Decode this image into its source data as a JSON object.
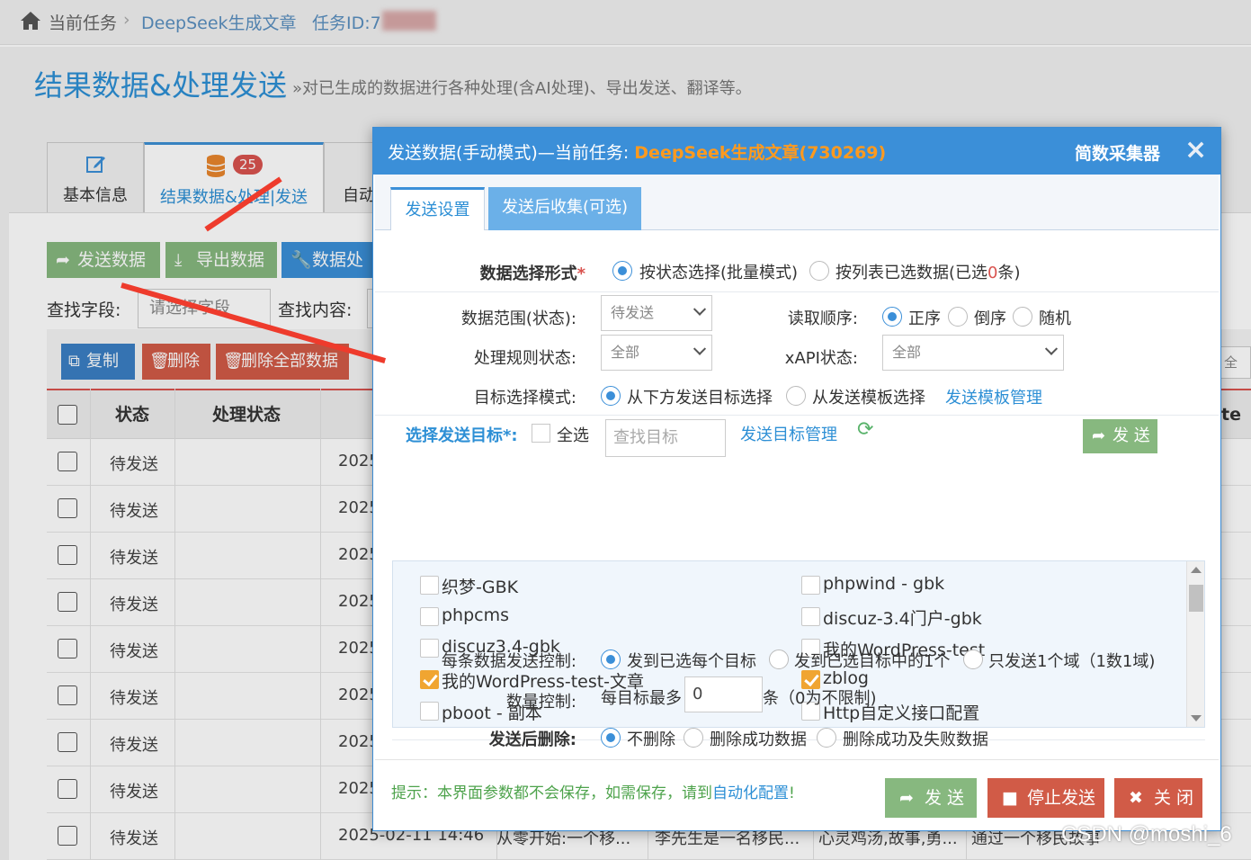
{
  "breadcrumb": {
    "current_task": "当前任务",
    "task_name": "DeepSeek生成文章",
    "task_id": "任务ID:7"
  },
  "page": {
    "title": "结果数据&处理发送",
    "subtitle": "»对已生成的数据进行各种处理(含AI处理)、导出发送、翻译等。"
  },
  "tabs": [
    {
      "label": "基本信息"
    },
    {
      "label": "结果数据&处理|发送",
      "badge": "25"
    },
    {
      "label": "自动"
    }
  ],
  "toolbar": {
    "send": "发送数据",
    "export": "导出数据",
    "process": "数据处"
  },
  "search": {
    "field_label": "查找字段:",
    "field_placeholder": "请选择字段",
    "content_label": "查找内容:"
  },
  "actions": {
    "copy": "复制",
    "delete": "删除",
    "delete_all": "删除全部数据",
    "right_hint": "全部"
  },
  "table": {
    "headers": [
      "状态",
      "处理状态",
      "",
      "te"
    ],
    "rows": [
      {
        "status": "待发送",
        "date": "2025"
      },
      {
        "status": "待发送",
        "date": "2025"
      },
      {
        "status": "待发送",
        "date": "2025"
      },
      {
        "status": "待发送",
        "date": "2025"
      },
      {
        "status": "待发送",
        "date": "2025"
      },
      {
        "status": "待发送",
        "date": "2025"
      },
      {
        "status": "待发送",
        "date": "2025"
      },
      {
        "status": "待发送",
        "date": "2025"
      },
      {
        "status": "待发送",
        "date": "2025-02-11 14:46",
        "c1": "从零开始:一个移...",
        "c2": "李先生是一名移民...",
        "c3": "心灵鸡汤,故事,勇...",
        "c4": "通过一个移民故事"
      }
    ]
  },
  "modal": {
    "title_prefix": "发送数据(手动模式)—当前任务: ",
    "task": "DeepSeek生成文章(730269)",
    "brand": "简数采集器",
    "close_icon": "×",
    "tabs": [
      "发送设置",
      "发送后收集(可选)"
    ],
    "selection_mode_label": "数据选择形式",
    "required_mark": "*",
    "selection_modes": [
      "按状态选择(批量模式)",
      "按列表已选数据(已选",
      "0",
      "条)"
    ],
    "data_range_label": "数据范围(状态):",
    "data_range_value": "待发送",
    "read_order_label": "读取顺序:",
    "read_orders": [
      "正序",
      "倒序",
      "随机"
    ],
    "rule_status_label": "处理规则状态:",
    "rule_status_value": "全部",
    "xapi_label": "xAPI状态:",
    "xapi_value": "全部",
    "target_mode_label": "目标选择模式:",
    "target_modes": [
      "从下方发送目标选择",
      "从发送模板选择"
    ],
    "template_link": "发送模板管理",
    "target_select_label": "选择发送目标*:",
    "select_all": "全选",
    "search_placeholder": "查找目标",
    "target_manage_link": "发送目标管理",
    "send_small": "发 送",
    "targets": [
      {
        "name": "织梦-GBK",
        "checked": false
      },
      {
        "name": "phpwind - gbk",
        "checked": false
      },
      {
        "name": "phpcms",
        "checked": false
      },
      {
        "name": "discuz-3.4门户-gbk",
        "checked": false
      },
      {
        "name": "discuz3.4-gbk",
        "checked": false
      },
      {
        "name": "我的WordPress-test",
        "checked": false
      },
      {
        "name": "我的WordPress-test-文章",
        "checked": true
      },
      {
        "name": "zblog",
        "checked": true
      },
      {
        "name": "pboot - 副本",
        "checked": false
      },
      {
        "name": "Http自定义接口配置",
        "checked": false
      }
    ],
    "per_item_label": "每条数据发送控制:",
    "per_item_options": [
      "发到已选每个目标",
      "发到已选目标中的1个",
      "只发送1个域（1数1域)"
    ],
    "quantity_label": "数量控制:",
    "quantity_prefix": "每目标最多",
    "quantity_value": "0",
    "quantity_suffix": "条（0为不限制)",
    "after_delete_label": "发送后删除:",
    "after_delete_options": [
      "不删除",
      "删除成功数据",
      "删除成功及失败数据"
    ],
    "tip_prefix": "提示：本界面参数都不会保存，如需保存，请到",
    "tip_link": "自动化配置",
    "tip_suffix": "!",
    "footer_buttons": [
      "发 送",
      "停止发送",
      "关 闭"
    ]
  },
  "watermark": "CSDN @moshi_6",
  "colors": {
    "primary": "#3b8fd8",
    "accent_orange": "#ff9a1e",
    "send_green": "#87b87f",
    "danger": "#d15b47",
    "checked_orange": "#f0a531"
  }
}
